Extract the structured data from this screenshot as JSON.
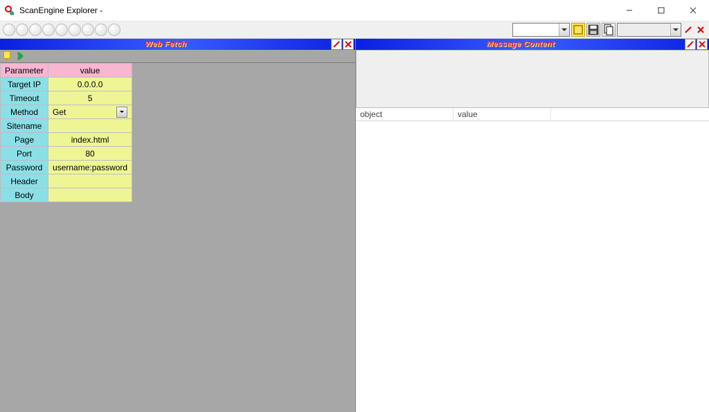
{
  "window": {
    "title": "ScanEngine Explorer -"
  },
  "toolbar": {
    "combo1_value": "",
    "combo2_value": ""
  },
  "panels": {
    "left": {
      "title": "Web Fetch",
      "params_header": {
        "col1": "Parameter",
        "col2": "value"
      },
      "params": [
        {
          "name": "Target IP",
          "value": "0.0.0.0"
        },
        {
          "name": "Timeout",
          "value": "5"
        },
        {
          "name": "Method",
          "value": "Get",
          "dropdown": true
        },
        {
          "name": "Sitename",
          "value": ""
        },
        {
          "name": "Page",
          "value": "index.html"
        },
        {
          "name": "Port",
          "value": "80"
        },
        {
          "name": "Password",
          "value": "username:password"
        },
        {
          "name": "Header",
          "value": ""
        },
        {
          "name": "Body",
          "value": ""
        }
      ]
    },
    "right": {
      "title": "Message Content",
      "columns": {
        "c1": "object",
        "c2": "value"
      }
    }
  }
}
